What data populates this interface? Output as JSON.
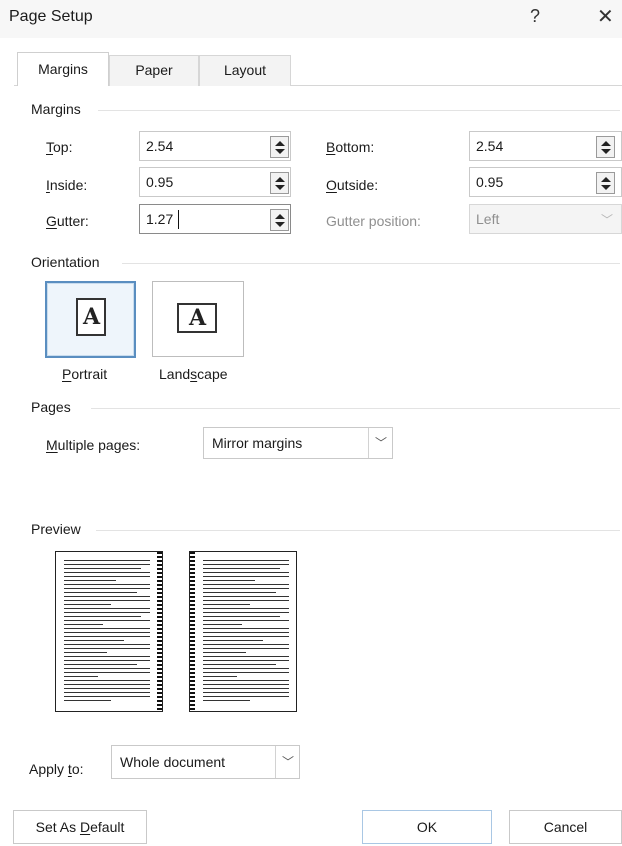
{
  "window": {
    "title": "Page Setup",
    "help": "?",
    "close": "✕"
  },
  "tabs": [
    {
      "label": "Margins",
      "active": true
    },
    {
      "label": "Paper",
      "active": false
    },
    {
      "label": "Layout",
      "active": false
    }
  ],
  "margins": {
    "section": "Margins",
    "top": {
      "label_key": "T",
      "label_rest": "op:",
      "value": "2.54"
    },
    "bottom": {
      "label_key": "B",
      "label_rest": "ottom:",
      "value": "2.54"
    },
    "inside": {
      "label_key": "I",
      "label_rest": "nside:",
      "value": "0.95"
    },
    "outside": {
      "label_key": "O",
      "label_rest": "utside:",
      "value": "0.95"
    },
    "gutter": {
      "label_key": "G",
      "label_rest": "utter:",
      "value": "1.27"
    },
    "gutter_position": {
      "label": "Gutter position:",
      "value": "Left"
    }
  },
  "orientation": {
    "section": "Orientation",
    "portrait": {
      "label_key": "P",
      "label_rest": "ortrait",
      "selected": true
    },
    "landscape": {
      "label_pre": "Land",
      "label_key": "s",
      "label_rest": "cape",
      "selected": false
    },
    "icon_letter": "A"
  },
  "pages": {
    "section": "Pages",
    "multiple_label_key": "M",
    "multiple_label_rest": "ultiple pages:",
    "multiple_value": "Mirror margins"
  },
  "preview": {
    "section": "Preview"
  },
  "apply": {
    "label_pre": "Apply ",
    "label_key": "t",
    "label_rest": "o:",
    "value": "Whole document"
  },
  "footer": {
    "default_pre": "Set As ",
    "default_key": "D",
    "default_rest": "efault",
    "ok": "OK",
    "cancel": "Cancel"
  },
  "colors": {
    "accent": "#5a8ec0",
    "disabled_text": "#8f8f8f"
  }
}
